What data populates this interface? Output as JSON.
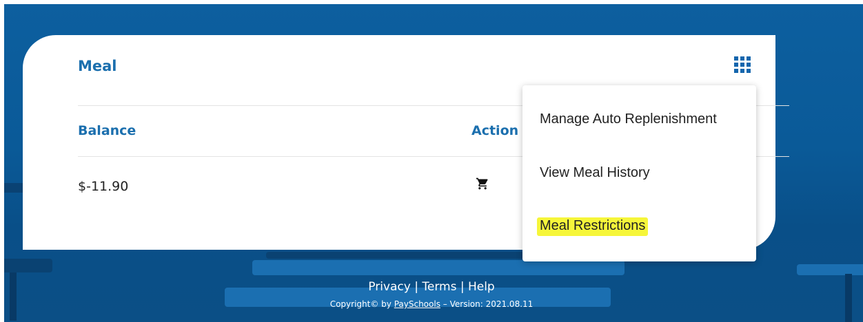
{
  "card": {
    "title": "Meal",
    "menu_button_icon": "grid-icon",
    "columns": {
      "balance": "Balance",
      "action": "Action"
    },
    "balance_value": "$-11.90",
    "action_icon": "cart-icon"
  },
  "menu": {
    "items": [
      {
        "label": "Manage Auto Replenishment"
      },
      {
        "label": "View Meal History"
      },
      {
        "label": "Meal Restrictions",
        "highlighted": true
      }
    ]
  },
  "footer": {
    "privacy": "Privacy",
    "terms": "Terms",
    "help": "Help",
    "separator": "|",
    "copyright_prefix": "Copyright© by",
    "company": "PaySchools",
    "version": "– Version: 2021.08.11"
  },
  "colors": {
    "brand_blue": "#1b6fae",
    "highlight": "#f6f63a",
    "background": "#0a5a98"
  }
}
